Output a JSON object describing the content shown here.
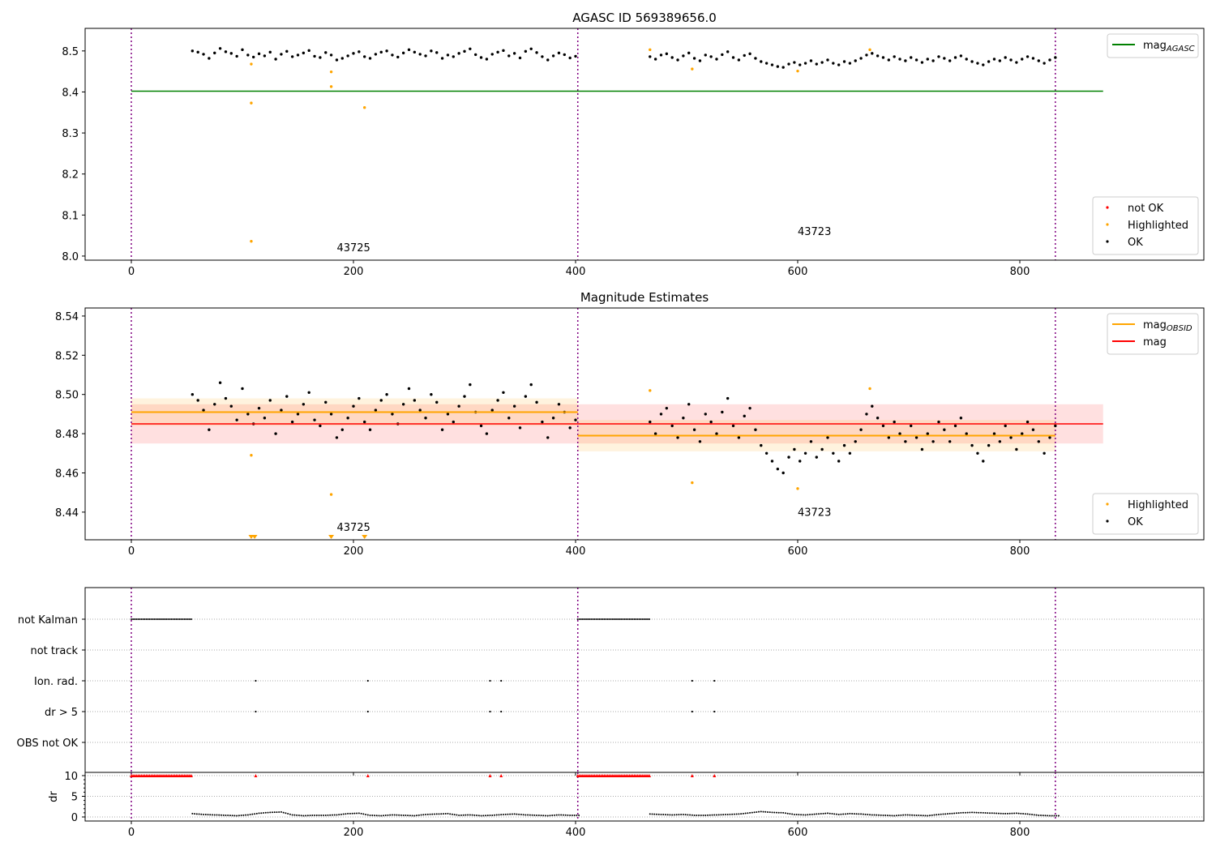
{
  "chart_data": [
    {
      "type": "scatter",
      "title": "AGASC ID 569389656.0",
      "xlim": [
        -41.6,
        965.7
      ],
      "ylim": [
        7.99,
        8.555
      ],
      "xticks": [
        0,
        200,
        400,
        600,
        800
      ],
      "yticks": [
        8.0,
        8.1,
        8.2,
        8.3,
        8.4,
        8.5
      ],
      "obsid_boundaries": [
        0,
        402,
        832
      ],
      "mag_agasc": {
        "value": 8.402,
        "x_range": [
          0,
          875
        ],
        "color": "#008000"
      },
      "obsid_labels": [
        {
          "text": "43725",
          "x": 185,
          "y": 8.012
        },
        {
          "text": "43723",
          "x": 600,
          "y": 8.051
        }
      ],
      "highlighted": [
        [
          108,
          8.468
        ],
        [
          108,
          8.373
        ],
        [
          108,
          8.036
        ],
        [
          180,
          8.449
        ],
        [
          180,
          8.413
        ],
        [
          210,
          8.362
        ],
        [
          467,
          8.503
        ],
        [
          505,
          8.456
        ],
        [
          600,
          8.451
        ],
        [
          665,
          8.503
        ]
      ],
      "legend_top": [
        {
          "label": "mag",
          "sub": "AGASC",
          "color": "#008000",
          "kind": "line"
        }
      ],
      "legend_bottom": [
        {
          "label": "not OK",
          "color": "#ff0000"
        },
        {
          "label": "Highlighted",
          "color": "#ffa500"
        },
        {
          "label": "OK",
          "color": "#000000"
        }
      ],
      "grid": false
    },
    {
      "type": "scatter",
      "title": "Magnitude Estimates",
      "xlim": [
        -41.6,
        965.7
      ],
      "ylim": [
        8.4259,
        8.5441
      ],
      "xticks": [
        0,
        200,
        400,
        600,
        800
      ],
      "yticks": [
        8.44,
        8.46,
        8.48,
        8.5,
        8.52,
        8.54
      ],
      "obsid_boundaries": [
        0,
        402,
        832
      ],
      "mag": {
        "value": 8.485,
        "band": [
          8.475,
          8.495
        ],
        "x_range": [
          0,
          875
        ],
        "color": "#ff0000"
      },
      "mag_obsid": [
        {
          "value": 8.491,
          "band": [
            8.484,
            8.498
          ],
          "x_range": [
            0,
            402
          ]
        },
        {
          "value": 8.479,
          "band": [
            8.471,
            8.487
          ],
          "x_range": [
            402,
            832
          ]
        }
      ],
      "obsid_labels": [
        {
          "text": "43725",
          "x": 185,
          "y": 8.4305
        },
        {
          "text": "43723",
          "x": 600,
          "y": 8.438
        }
      ],
      "highlighted": [
        [
          108,
          8.469
        ],
        [
          180,
          8.449
        ],
        [
          467,
          8.502
        ],
        [
          505,
          8.455
        ],
        [
          600,
          8.452
        ],
        [
          665,
          8.503
        ]
      ],
      "below_range_markers_x": [
        108,
        111,
        180,
        210
      ],
      "legend_top": [
        {
          "label": "mag",
          "sub": "OBSID",
          "color": "#ffa500",
          "kind": "line"
        },
        {
          "label": "mag",
          "sub": "",
          "color": "#ff0000",
          "kind": "line"
        }
      ],
      "legend_bottom": [
        {
          "label": "Highlighted",
          "color": "#ffa500"
        },
        {
          "label": "OK",
          "color": "#000000"
        }
      ],
      "grid": false
    },
    {
      "type": "scatter",
      "xlim": [
        -41.6,
        965.7
      ],
      "xticks": [
        0,
        200,
        400,
        600,
        800
      ],
      "flag_rows": [
        "not Kalman",
        "not track",
        "Ion. rad.",
        "dr > 5",
        "OBS not OK"
      ],
      "not_kalman_ranges": [
        [
          0,
          55
        ],
        [
          402,
          467
        ]
      ],
      "ion_rad_x": [
        112,
        213,
        323,
        333,
        505,
        525
      ],
      "dr_gt5_x": [
        112,
        213,
        323,
        333,
        505,
        525
      ],
      "dr": {
        "ylabel": "dr",
        "ylim": [
          -0.98,
          10.78
        ],
        "yticks": [
          0,
          5,
          10
        ],
        "clipped_value": 10,
        "clipped_ranges": [
          [
            0,
            55
          ],
          [
            402,
            467
          ]
        ],
        "clipped_x": [
          112,
          213,
          323,
          333,
          505,
          525
        ],
        "segments": [
          {
            "x_start": 55,
            "x_step": 10,
            "y": [
              0.8,
              0.6,
              0.5,
              0.4,
              0.3,
              0.5,
              0.9,
              1.1,
              1.2,
              0.5,
              0.3,
              0.4,
              0.4,
              0.5,
              0.8,
              0.9,
              0.4,
              0.3,
              0.5,
              0.4,
              0.3,
              0.6,
              0.7,
              0.8,
              0.4,
              0.5,
              0.3,
              0.4,
              0.6,
              0.7,
              0.5,
              0.4,
              0.3,
              0.5,
              0.4
            ]
          },
          {
            "x_start": 467,
            "x_step": 10,
            "y": [
              0.7,
              0.6,
              0.5,
              0.6,
              0.4,
              0.4,
              0.5,
              0.6,
              0.7,
              1.0,
              1.3,
              1.1,
              1.0,
              0.6,
              0.5,
              0.7,
              0.9,
              0.6,
              0.8,
              0.7,
              0.5,
              0.4,
              0.3,
              0.5,
              0.4,
              0.3,
              0.6,
              0.8,
              1.0,
              1.1,
              1.0,
              0.9,
              0.8,
              0.9,
              0.7,
              0.4,
              0.3
            ]
          }
        ]
      }
    }
  ],
  "ok_segments": [
    {
      "x_start": 55,
      "x_step": 5,
      "y": [
        8.5,
        8.497,
        8.492,
        8.482,
        8.495,
        8.506,
        8.498,
        8.494,
        8.487,
        8.503,
        8.49,
        8.485,
        8.493,
        8.488,
        8.497,
        8.48,
        8.492,
        8.499,
        8.486,
        8.49,
        8.495,
        8.501,
        8.487,
        8.484,
        8.496,
        8.49,
        8.478,
        8.482,
        8.488,
        8.494,
        8.498,
        8.486,
        8.482,
        8.492,
        8.497,
        8.5,
        8.49,
        8.485,
        8.495,
        8.503,
        8.497,
        8.492,
        8.488,
        8.5,
        8.496,
        8.482,
        8.49,
        8.486,
        8.494,
        8.499,
        8.505,
        8.491,
        8.484,
        8.48,
        8.492,
        8.497,
        8.501,
        8.488,
        8.494,
        8.483,
        8.499,
        8.505,
        8.496,
        8.486,
        8.478,
        8.488,
        8.495,
        8.491,
        8.483,
        8.487
      ]
    },
    {
      "x_start": 467,
      "x_step": 5,
      "y": [
        8.486,
        8.48,
        8.49,
        8.493,
        8.484,
        8.478,
        8.488,
        8.495,
        8.482,
        8.476,
        8.49,
        8.486,
        8.48,
        8.491,
        8.498,
        8.484,
        8.478,
        8.489,
        8.493,
        8.482,
        8.474,
        8.47,
        8.466,
        8.462,
        8.46,
        8.468,
        8.472,
        8.466,
        8.47,
        8.476,
        8.468,
        8.472,
        8.478,
        8.47,
        8.466,
        8.474,
        8.47,
        8.476,
        8.482,
        8.49,
        8.494,
        8.488,
        8.484,
        8.478,
        8.486,
        8.48,
        8.476,
        8.484,
        8.478,
        8.472,
        8.48,
        8.476,
        8.486,
        8.482,
        8.476,
        8.484,
        8.488,
        8.48,
        8.474,
        8.47,
        8.466,
        8.474,
        8.48,
        8.476,
        8.484,
        8.478,
        8.472,
        8.48,
        8.486,
        8.482,
        8.476,
        8.47,
        8.478,
        8.484
      ]
    }
  ],
  "colors": {
    "ok": "#000000",
    "highlighted": "#ffa500",
    "not_ok": "#ff0000",
    "obsid_line": "#800080",
    "mag_agasc": "#008000",
    "mag": "#ff0000",
    "mag_obsid": "#ffa500"
  }
}
